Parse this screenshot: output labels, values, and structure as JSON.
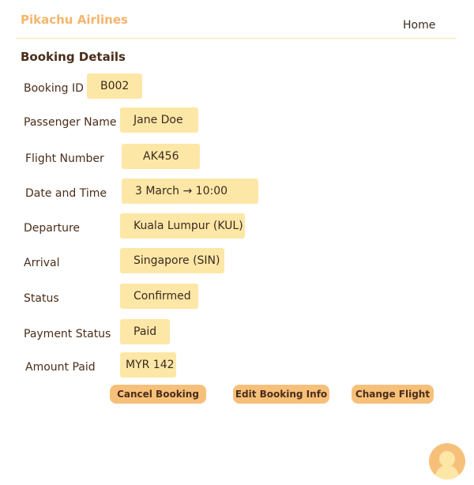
{
  "header": {
    "brand": "Pikachu Airlines",
    "nav_home": "Home"
  },
  "section_title": "Booking Details",
  "fields": {
    "booking_id": {
      "label": "Booking ID",
      "value": "B002"
    },
    "passenger_name": {
      "label": "Passenger Name",
      "value": "Jane Doe"
    },
    "flight_number": {
      "label": "Flight Number",
      "value": "AK456"
    },
    "date_time": {
      "label": "Date and Time",
      "value": "3 March → 10:00"
    },
    "departure": {
      "label": "Departure",
      "value": "Kuala Lumpur (KUL)"
    },
    "arrival": {
      "label": "Arrival",
      "value": "Singapore (SIN)"
    },
    "status": {
      "label": "Status",
      "value": "Confirmed"
    },
    "payment_status": {
      "label": "Payment Status",
      "value": "Paid"
    },
    "amount_paid": {
      "label": "Amount Paid",
      "value": "MYR 142"
    }
  },
  "actions": {
    "cancel": "Cancel Booking",
    "edit": "Edit Booking Info",
    "change": "Change Flight"
  },
  "icons": {
    "profile": "user-avatar-icon"
  },
  "colors": {
    "brand": "#f5b56c",
    "value_bg": "#fde7a7",
    "button_bg": "#f7c07a",
    "text": "#4a2d1a"
  }
}
